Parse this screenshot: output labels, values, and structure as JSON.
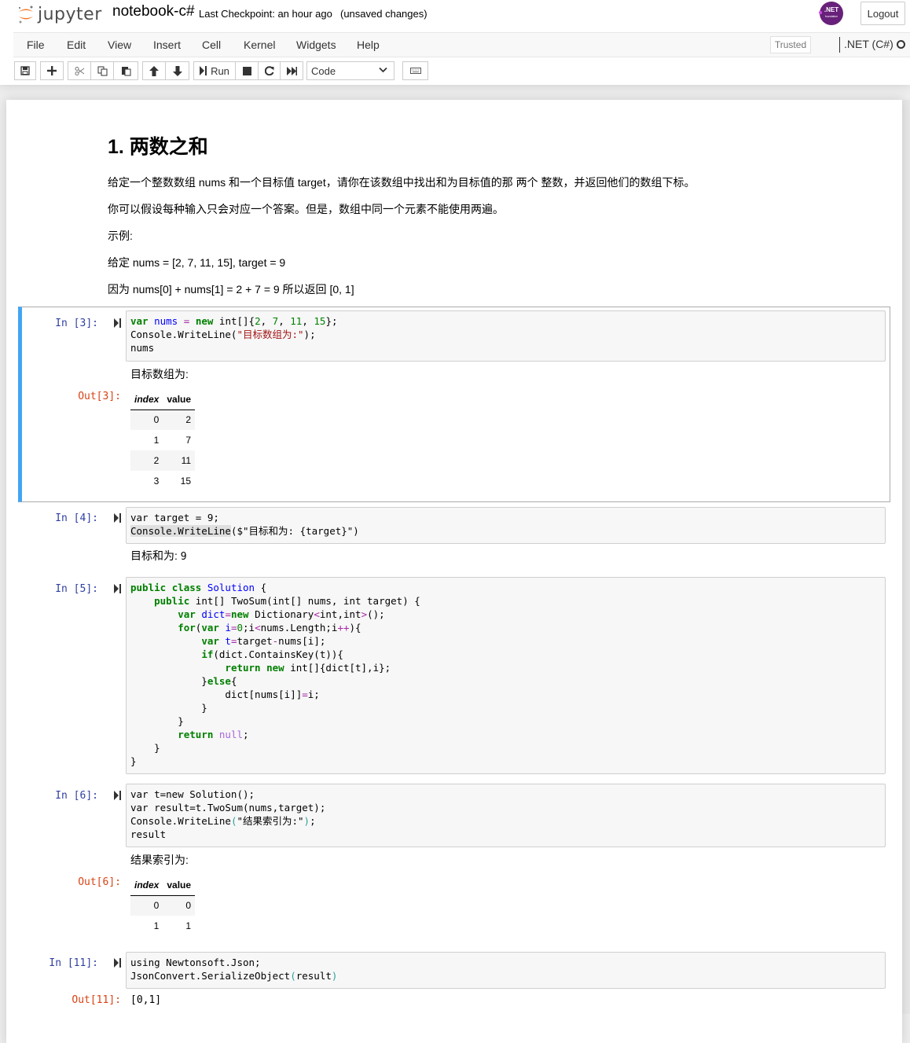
{
  "header": {
    "logo_text": "jupyter",
    "notebook_name": "notebook-c#",
    "checkpoint": "Last Checkpoint: an hour ago",
    "autosave_status": "(unsaved changes)",
    "net_logo": {
      "main": ".NET",
      "sub": "foundation"
    },
    "logout_label": "Logout"
  },
  "menubar": {
    "items": [
      "File",
      "Edit",
      "View",
      "Insert",
      "Cell",
      "Kernel",
      "Widgets",
      "Help"
    ],
    "trusted_label": "Trusted",
    "kernel_name": ".NET (C#)"
  },
  "toolbar": {
    "icons": [
      "save-icon",
      "plus-icon",
      "cut-icon",
      "copy-icon",
      "paste-icon",
      "arrow-up-icon",
      "arrow-down-icon",
      "step-forward-icon",
      "stop-icon",
      "restart-icon",
      "fast-forward-icon",
      "keyboard-icon"
    ],
    "run_label": "Run",
    "cell_type": "Code"
  },
  "markdown": {
    "title": "1. 两数之和",
    "p1": "给定一个整数数组 nums 和一个目标值 target，请你在该数组中找出和为目标值的那 两个 整数，并返回他们的数组下标。",
    "p2": "你可以假设每种输入只会对应一个答案。但是，数组中同一个元素不能使用两遍。",
    "p3": "示例:",
    "p4": "给定 nums = [2, 7, 11, 15], target = 9",
    "p5": "因为 nums[0] + nums[1] = 2 + 7 = 9 所以返回 [0, 1]"
  },
  "cells": [
    {
      "in_prompt": "In [3]:",
      "out_prompt": "Out[3]:",
      "code_lines": [
        "var nums = new int[]{2, 7, 11, 15};",
        "Console.WriteLine(\"目标数组为:\");",
        "nums"
      ],
      "stdout": "目标数组为:",
      "table": {
        "headers": [
          "index",
          "value"
        ],
        "rows": [
          [
            "0",
            "2"
          ],
          [
            "1",
            "7"
          ],
          [
            "2",
            "11"
          ],
          [
            "3",
            "15"
          ]
        ]
      }
    },
    {
      "in_prompt": "In [4]:",
      "code_lines": [
        "var target = 9;",
        "Console.WriteLine($\"目标和为: {target}\")"
      ],
      "stdout_text": "目标和为:",
      "stdout_value": "9"
    },
    {
      "in_prompt": "In [5]:",
      "code_lines": [
        "public class Solution {",
        "    public int[] TwoSum(int[] nums, int target) {",
        "        var dict=new Dictionary<int,int>();",
        "        for(var i=0;i<nums.Length;i++){",
        "            var t=target-nums[i];",
        "            if(dict.ContainsKey(t)){",
        "                return new int[]{dict[t],i};",
        "            }else{",
        "                dict[nums[i]]=i;",
        "            }",
        "        }",
        "        return null;",
        "    }",
        "}"
      ]
    },
    {
      "in_prompt": "In [6]:",
      "out_prompt": "Out[6]:",
      "code_lines": [
        "var t=new Solution();",
        "var result=t.TwoSum(nums,target);",
        "Console.WriteLine(\"结果索引为:\");",
        "result"
      ],
      "stdout": "结果索引为:",
      "table": {
        "headers": [
          "index",
          "value"
        ],
        "rows": [
          [
            "0",
            "0"
          ],
          [
            "1",
            "1"
          ]
        ]
      }
    },
    {
      "in_prompt": "In [11]:",
      "out_prompt": "Out[11]:",
      "code_lines": [
        "using Newtonsoft.Json;",
        "JsonConvert.SerializeObject(result)"
      ],
      "output": "[0,1]"
    }
  ],
  "colors": {
    "selected_cell_accent": "#42a5f5",
    "in_prompt": "#303f9f",
    "out_prompt": "#d84315",
    "jupyter_orange": "#f37726",
    "net_purple": "#68217a"
  }
}
